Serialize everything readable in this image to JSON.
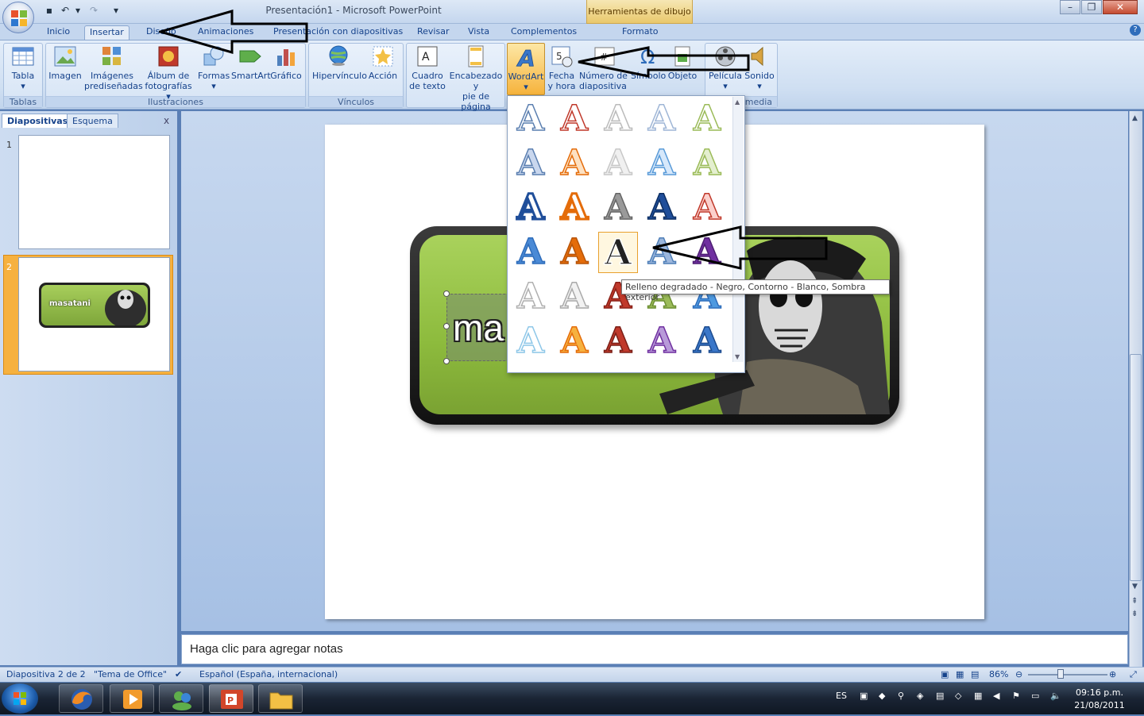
{
  "window": {
    "title": "Presentación1 - Microsoft PowerPoint",
    "contextual_tab_title": "Herramientas de dibujo"
  },
  "tabs": [
    {
      "label": "Inicio"
    },
    {
      "label": "Insertar"
    },
    {
      "label": "Diseño"
    },
    {
      "label": "Animaciones"
    },
    {
      "label": "Presentación con diapositivas"
    },
    {
      "label": "Revisar"
    },
    {
      "label": "Vista"
    },
    {
      "label": "Complementos"
    },
    {
      "label": "Formato"
    }
  ],
  "ribbon": {
    "groups": {
      "tablas": "Tablas",
      "ilustraciones": "Ilustraciones",
      "vinculos": "Vínculos",
      "multimedia": "imedia"
    },
    "buttons": {
      "tabla": "Tabla",
      "imagen": "Imagen",
      "imagenes_1": "Imágenes",
      "imagenes_2": "prediseñadas",
      "album_1": "Álbum de",
      "album_2": "fotografías",
      "formas": "Formas",
      "smartart": "SmartArt",
      "grafico": "Gráfico",
      "hipervinculo": "Hipervínculo",
      "accion": "Acción",
      "cuadro_1": "Cuadro",
      "cuadro_2": "de texto",
      "encabezado_1": "Encabezado y",
      "encabezado_2": "pie de página",
      "wordart": "WordArt",
      "fecha_1": "Fecha",
      "fecha_2": "y hora",
      "numero_1": "Número de",
      "numero_2": "diapositiva",
      "simbolo": "Símbolo",
      "objeto": "Objeto",
      "pelicula": "Película",
      "sonido": "Sonido"
    }
  },
  "left_panel": {
    "tab_slides": "Diapositivas",
    "tab_outline": "Esquema",
    "close": "x",
    "slides": [
      {
        "number": "1"
      },
      {
        "number": "2",
        "banner_text": "masatani"
      }
    ]
  },
  "slide": {
    "textbox_text": "ma"
  },
  "wordart_gallery": {
    "glyph": "A",
    "tooltip": "Relleno degradado - Negro, Contorno - Blanco, Sombra exterior",
    "colors": {
      "blue_outline": "#5b7fb0",
      "red": "#c0392b",
      "green": "#9bbb59",
      "orange": "#e46c0a",
      "dark_blue": "#1f4e9a",
      "purple": "#7030a0",
      "black": "#222222",
      "light_blue": "#8ec7e8"
    }
  },
  "notes": {
    "placeholder": "Haga clic para agregar notas"
  },
  "status_bar": {
    "slide_info": "Diapositiva 2 de 2",
    "theme": "\"Tema de Office\"",
    "language": "Español (España, internacional)",
    "zoom": "86%"
  },
  "taskbar": {
    "language": "ES",
    "time": "09:16 p.m.",
    "date": "21/08/2011"
  }
}
